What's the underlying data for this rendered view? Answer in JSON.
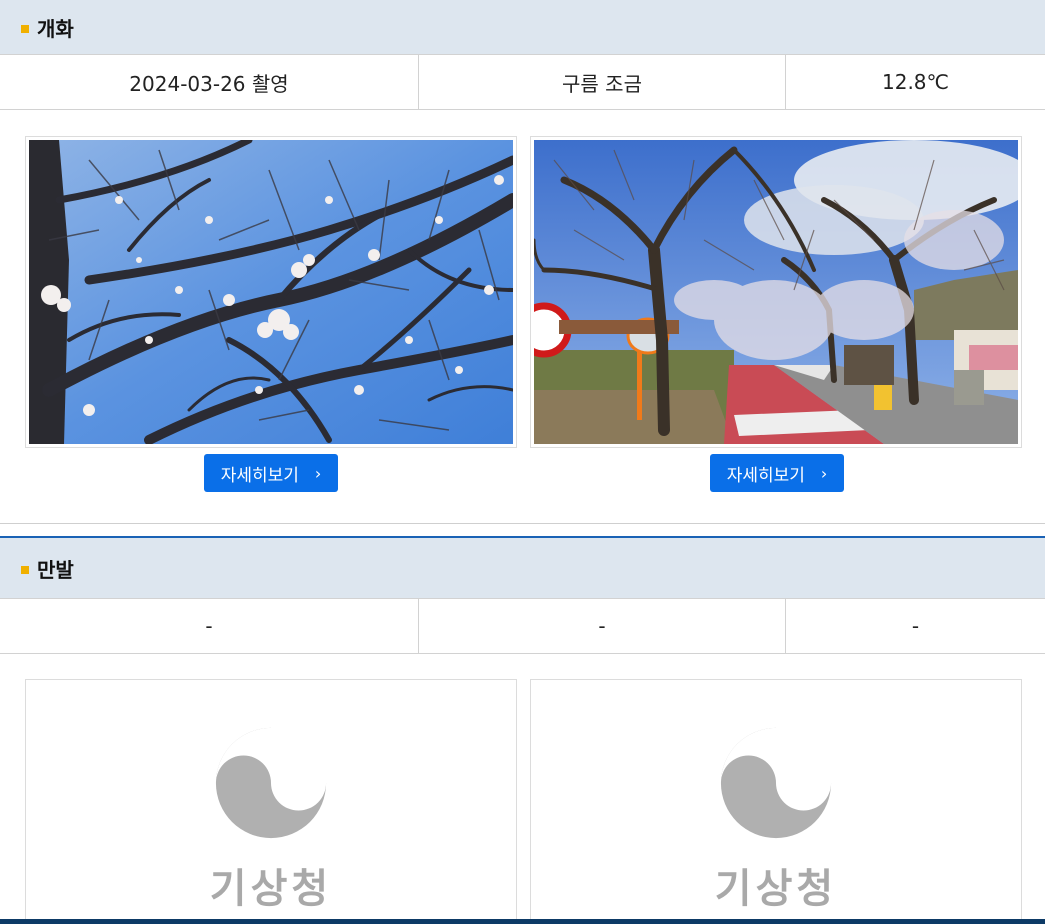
{
  "bloom": {
    "title": "개화",
    "date": "2024-03-26 촬영",
    "weather": "구름 조금",
    "temperature": "12.8℃",
    "detail_label": "자세히보기",
    "photos": [
      {
        "icon": "cherry-blossom-branch-photo"
      },
      {
        "icon": "cherry-blossom-street-photo"
      }
    ]
  },
  "full_bloom": {
    "title": "만발",
    "date": "-",
    "weather": "-",
    "temperature": "-",
    "logo_text": "기상청"
  },
  "colors": {
    "header_bg": "#dde6ef",
    "bullet": "#f0b000",
    "button": "#0a6fe8",
    "divider_blue": "#1a62b5"
  }
}
